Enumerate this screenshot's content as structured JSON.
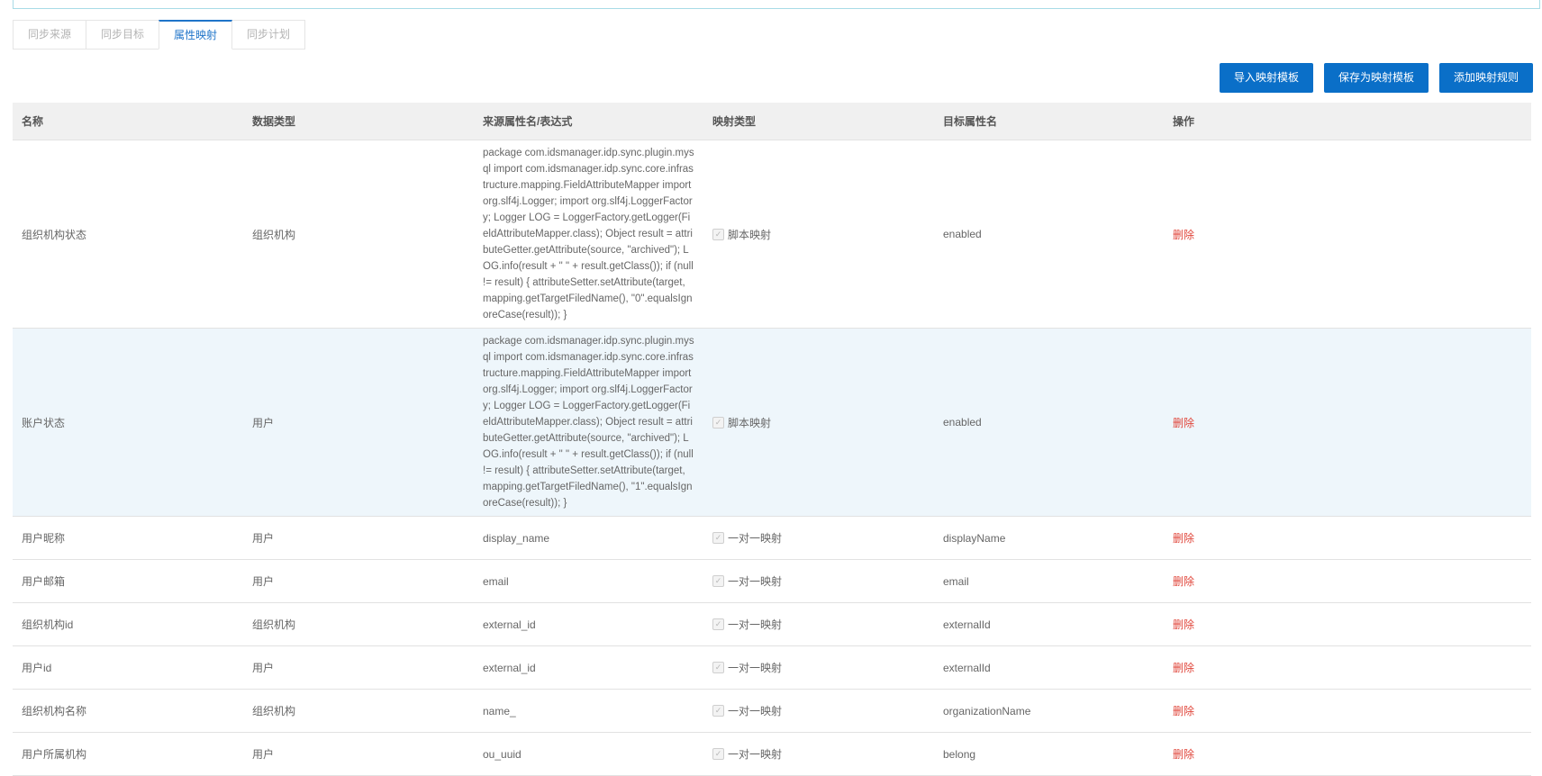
{
  "tabs": [
    {
      "label": "同步来源",
      "active": false
    },
    {
      "label": "同步目标",
      "active": false
    },
    {
      "label": "属性映射",
      "active": true
    },
    {
      "label": "同步计划",
      "active": false
    }
  ],
  "toolbar": {
    "import_label": "导入映射模板",
    "save_label": "保存为映射模板",
    "add_label": "添加映射规则"
  },
  "table": {
    "headers": [
      "名称",
      "数据类型",
      "来源属性名/表达式",
      "映射类型",
      "目标属性名",
      "操作"
    ],
    "rows": [
      {
        "name": "组织机构状态",
        "data_type": "组织机构",
        "source": "package com.idsmanager.idp.sync.plugin.mysql import com.idsmanager.idp.sync.core.infrastructure.mapping.FieldAttributeMapper import org.slf4j.Logger; import org.slf4j.LoggerFactory; Logger LOG = LoggerFactory.getLogger(FieldAttributeMapper.class); Object result = attributeGetter.getAttribute(source, \"archived\"); LOG.info(result + \" \" + result.getClass()); if (null != result) { attributeSetter.setAttribute(target, mapping.getTargetFiledName(), \"0\".equalsIgnoreCase(result)); }",
        "map_type": "脚本映射",
        "target": "enabled",
        "action": "删除"
      },
      {
        "name": "账户状态",
        "data_type": "用户",
        "source": "package com.idsmanager.idp.sync.plugin.mysql import com.idsmanager.idp.sync.core.infrastructure.mapping.FieldAttributeMapper import org.slf4j.Logger; import org.slf4j.LoggerFactory; Logger LOG = LoggerFactory.getLogger(FieldAttributeMapper.class); Object result = attributeGetter.getAttribute(source, \"archived\"); LOG.info(result + \" \" + result.getClass()); if (null != result) { attributeSetter.setAttribute(target, mapping.getTargetFiledName(), \"1\".equalsIgnoreCase(result)); }",
        "map_type": "脚本映射",
        "target": "enabled",
        "action": "删除"
      },
      {
        "name": "用户昵称",
        "data_type": "用户",
        "source": "display_name",
        "map_type": "一对一映射",
        "target": "displayName",
        "action": "删除"
      },
      {
        "name": "用户邮箱",
        "data_type": "用户",
        "source": "email",
        "map_type": "一对一映射",
        "target": "email",
        "action": "删除"
      },
      {
        "name": "组织机构id",
        "data_type": "组织机构",
        "source": "external_id",
        "map_type": "一对一映射",
        "target": "externalId",
        "action": "删除"
      },
      {
        "name": "用户id",
        "data_type": "用户",
        "source": "external_id",
        "map_type": "一对一映射",
        "target": "externalId",
        "action": "删除"
      },
      {
        "name": "组织机构名称",
        "data_type": "组织机构",
        "source": "name_",
        "map_type": "一对一映射",
        "target": "organizationName",
        "action": "删除"
      },
      {
        "name": "用户所属机构",
        "data_type": "用户",
        "source": "ou_uuid",
        "map_type": "一对一映射",
        "target": "belong",
        "action": "删除"
      }
    ]
  },
  "colors": {
    "primary": "#0a6fc8",
    "active_tab": "#1f74c9",
    "delete": "#e0453a",
    "highlight_row": "#eef6fb"
  },
  "icons": {
    "checkbox": "check-icon"
  }
}
